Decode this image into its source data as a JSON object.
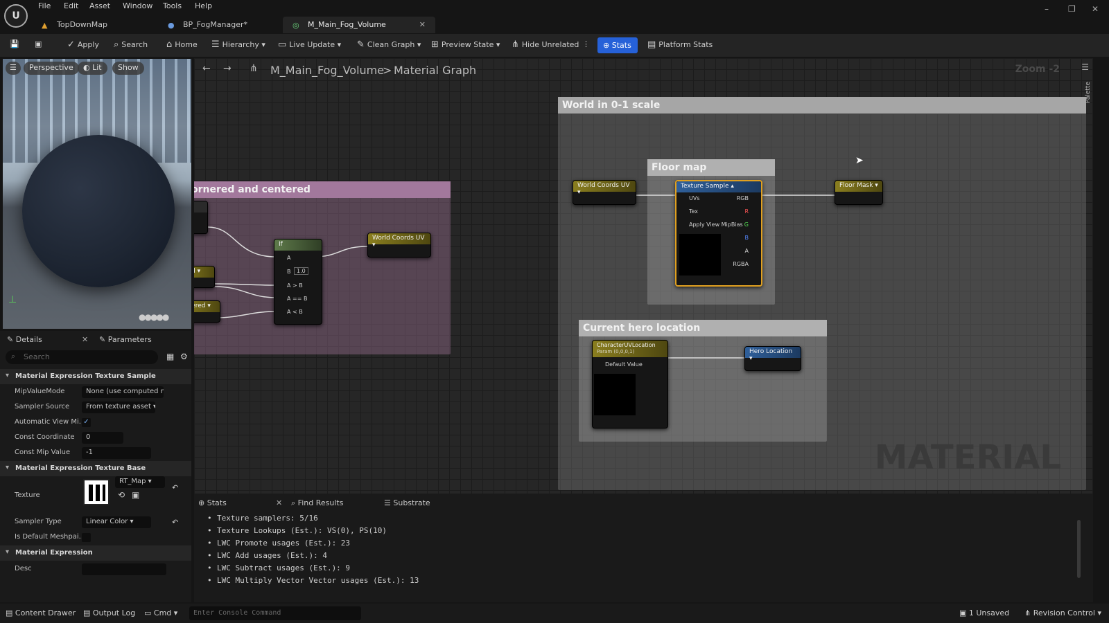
{
  "menu": [
    "File",
    "Edit",
    "Asset",
    "Window",
    "Tools",
    "Help"
  ],
  "logo": "U",
  "tabs": [
    {
      "label": "TopDownMap",
      "icon": "level-icon"
    },
    {
      "label": "BP_FogManager*",
      "icon": "blueprint-icon"
    },
    {
      "label": "M_Main_Fog_Volume",
      "icon": "material-icon"
    }
  ],
  "toolbar": {
    "apply": "Apply",
    "search": "Search",
    "home": "Home",
    "hierarchy": "Hierarchy",
    "live_update": "Live Update",
    "clean_graph": "Clean Graph",
    "preview_state": "Preview State",
    "hide_unrelated": "Hide Unrelated",
    "stats": "Stats",
    "platform_stats": "Platform Stats"
  },
  "viewport": {
    "perspective": "Perspective",
    "lit": "Lit",
    "show": "Show"
  },
  "details": {
    "tab": "Details",
    "params_tab": "Parameters",
    "search_placeholder": "Search",
    "sect1": "Material Expression Texture Sample",
    "mip_label": "MipValueMode",
    "mip_value": "None (use computed m",
    "sampler_source_label": "Sampler Source",
    "sampler_source_value": "From texture asset",
    "auto_view_label": "Automatic View Mi...",
    "const_coord_label": "Const Coordinate",
    "const_coord_value": "0",
    "const_mip_label": "Const Mip Value",
    "const_mip_value": "-1",
    "sect2": "Material Expression Texture Base",
    "texture_label": "Texture",
    "texture_value": "RT_Map",
    "sampler_type_label": "Sampler Type",
    "sampler_type_value": "Linear Color",
    "is_default_label": "Is Default Meshpai...",
    "sect3": "Material Expression",
    "desc_label": "Desc"
  },
  "graph": {
    "asset": "M_Main_Fog_Volume",
    "sep": ">",
    "graph_name": "Material Graph",
    "zoom": "Zoom -2",
    "palette": "Palette",
    "watermark": "MATERIAL",
    "comment_world": "World in 0-1 scale",
    "comment_floor": "Floor map",
    "comment_hero": "Current hero location",
    "comment_left": "ornered and centered",
    "node_wcuv": "World Coords UV",
    "node_tex": "Texture Sample",
    "node_floor": "Floor Mask",
    "node_char": "CharacterUVLocation",
    "node_char_sub": "Param (0,0,0,1)",
    "node_hero": "Hero Location",
    "node_if": "If",
    "node_wcuv2": "World Coords UV",
    "node_red": "red",
    "node_ntered": "ntered",
    "pin_uvs": "UVs",
    "pin_tex": "Tex",
    "pin_mip": "Apply View MipBias",
    "pin_rgb": "RGB",
    "pin_r": "R",
    "pin_g": "G",
    "pin_b": "B",
    "pin_a": "A",
    "pin_rgba": "RGBA",
    "pin_default": "Default Value",
    "if_a": "A",
    "if_b": "B",
    "if_b_val": "1.0",
    "if_agb": "A > B",
    "if_aeb": "A == B",
    "if_alb": "A < B"
  },
  "stats": {
    "tab": "Stats",
    "find": "Find Results",
    "substrate": "Substrate",
    "lines": [
      "Texture samplers: 5/16",
      "Texture Lookups (Est.): VS(0), PS(10)",
      "LWC Promote usages (Est.): 23",
      "LWC Add usages (Est.): 4",
      "LWC Subtract usages (Est.): 9",
      "LWC Multiply Vector Vector usages (Est.): 13"
    ]
  },
  "status": {
    "content_drawer": "Content Drawer",
    "output_log": "Output Log",
    "cmd": "Cmd",
    "console_placeholder": "Enter Console Command",
    "unsaved": "1 Unsaved",
    "revision": "Revision Control"
  }
}
